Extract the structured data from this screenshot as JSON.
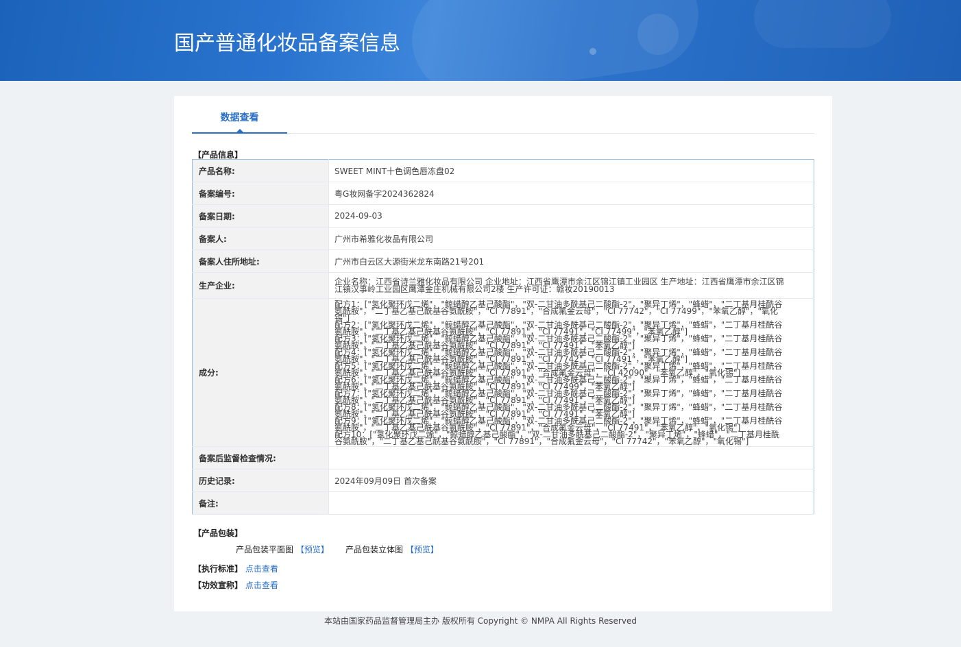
{
  "banner": {
    "title": "国产普通化妆品备案信息"
  },
  "tabs": [
    {
      "label": "数据查看"
    }
  ],
  "product_section": {
    "title": "【产品信息】"
  },
  "rows": [
    {
      "label": "产品名称:",
      "value": "SWEET MINT十色调色唇冻盘02"
    },
    {
      "label": "备案编号:",
      "value": "粤G妆网备字2024362824"
    },
    {
      "label": "备案日期:",
      "value": "2024-09-03"
    },
    {
      "label": "备案人:",
      "value": "广州市希雅化妆品有限公司"
    },
    {
      "label": "备案人住所地址:",
      "value": "广州市白云区大源街米龙东南路21号201"
    },
    {
      "label": "生产企业:",
      "value": "企业名称：江西省诗兰雅化妆品有限公司 企业地址：江西省鹰潭市余江区锦江镇工业园区 生产地址：江西省鹰潭市余江区锦江镇汉事岭工业园区鹰潭金庄机械有限公司2楼 生产许可证：赣妆20190013"
    },
    {
      "label": "成分:",
      "value": "配方1：[\"氢化聚环戊二烯\"，\"鲸蜡醇乙基己酸酯\"，\"双-二甘油多酰基己二酸酯-2\"，\"聚异丁烯\"，\"蜂蜡\"，\"二丁基月桂酰谷氨酰胺\"，\"二丁基乙基己酰基谷氨酰胺\"，\"CI 77891\"，\"合成氟金云母\"，\"CI 77742\"，\"CI 77499\"，\"苯氧乙醇\"，\"氧化锡\"]\n配方2：[\"氢化聚环戊二烯\"，\"鲸蜡醇乙基己酸酯\"，\"双-二甘油多酰基己二酸酯-2\"，\"聚异丁烯\"，\"蜂蜡\"，\"二丁基月桂酰谷氨酰胺\"，\"二丁基乙基己酰基谷氨酰胺\"，\"CI 77891\"，\"CI 77491\"，\"CI 77499\"，\"苯氧乙醇\"]\n配方3：[\"氢化聚环戊二烯\"，\"鲸蜡醇乙基己酸酯\"，\"双-二甘油多酰基己二酸酯-2\"，\"聚异丁烯\"，\"蜂蜡\"，\"二丁基月桂酰谷氨酰胺\"，\"二丁基乙基己酰基谷氨酰胺\"，\"CI 77891\"，\"CI 77491\"，\"苯氧乙醇\"]\n配方4：[\"氢化聚环戊二烯\"，\"鲸蜡醇乙基己酸酯\"，\"双-二甘油多酰基己二酸酯-2\"，\"聚异丁烯\"，\"蜂蜡\"，\"二丁基月桂酰谷氨酰胺\"，\"二丁基乙基己酰基谷氨酰胺\"，\"CI 77891\"，\"CI 77742\"，\"CI 77491\"，\"苯氧乙醇\"]\n配方5：[\"氢化聚环戊二烯\"，\"鲸蜡醇乙基己酸酯\"，\"双-二甘油多酰基己二酸酯-2\"，\"聚异丁烯\"，\"蜂蜡\"，\"二丁基月桂酰谷氨酰胺\"，\"二丁基乙基己酰基谷氨酰胺\"，\"CI 77891\"，\"合成氟金云母\"，\"CI 42090\"，\"苯氧乙醇\"，\"氧化锡\"]\n配方6：[\"氢化聚环戊二烯\"，\"鲸蜡醇乙基己酸酯\"，\"双-二甘油多酰基己二酸酯-2\"，\"聚异丁烯\"，\"蜂蜡\"，\"二丁基月桂酰谷氨酰胺\"，\"二丁基乙基己酰基谷氨酰胺\"，\"CI 77891\"，\"CI 77499\"，\"苯氧乙醇\"]\n配方7：[\"氢化聚环戊二烯\"，\"鲸蜡醇乙基己酸酯\"，\"双-二甘油多酰基己二酸酯-2\"，\"聚异丁烯\"，\"蜂蜡\"，\"二丁基月桂酰谷氨酰胺\"，\"二丁基乙基己酰基谷氨酰胺\"，\"CI 77891\"，\"CI 77491\"，\"苯氧乙醇\"]\n配方8：[\"氢化聚环戊二烯\"，\"鲸蜡醇乙基己酸酯\"，\"双-二甘油多酰基己二酸酯-2\"，\"聚异丁烯\"，\"蜂蜡\"，\"二丁基月桂酰谷氨酰胺\"，\"二丁基乙基己酰基谷氨酰胺\"，\"CI 77891\"，\"CI 77491\"，\"苯氧乙醇\"]\n配方9：[\"氢化聚环戊二烯\"，\"鲸蜡醇乙基己酸酯\"，\"双-二甘油多酰基己二酸酯-2\"，\"聚异丁烯\"，\"蜂蜡\"，\"二丁基月桂酰谷氨酰胺\"，\"二丁基乙基己酰基谷氨酰胺\"，\"CI 77891\"，\"合成氟金云母\"，\"CI 77491\"，\"苯氧乙醇\"，\"氧化锡\"]\n配方10：[\"氢化聚环戊二烯\"，\"鲸蜡醇乙基己酸酯\"，\"双-二甘油多酰基己二酸酯-2\"，\"聚异丁烯\"，\"蜂蜡\"，\"二丁基月桂酰谷氨酰胺\"，\"二丁基乙基己酰基谷氨酰胺\"，\"CI 77891\"，\"合成氟金云母\"，\"CI 77742\"，\"苯氧乙醇\"，\"氧化锡\"]"
    },
    {
      "label": "备案后监督检查情况:",
      "value": ""
    },
    {
      "label": "历史记录:",
      "value": "2024年09月09日 首次备案"
    },
    {
      "label": "备注:",
      "value": ""
    }
  ],
  "packaging": {
    "title": "【产品包装】",
    "flat_label": "产品包装平面图",
    "flat_link": "【预览】",
    "stereo_label": "产品包装立体图",
    "stereo_link": "【预览】"
  },
  "standard": {
    "label": "【执行标准】",
    "link": "点击查看"
  },
  "efficacy": {
    "label": "【功效宣称】",
    "link": "点击查看"
  },
  "footer": {
    "text": "本站由国家药品监督管理局主办 版权所有 Copyright © NMPA All Rights Reserved"
  }
}
